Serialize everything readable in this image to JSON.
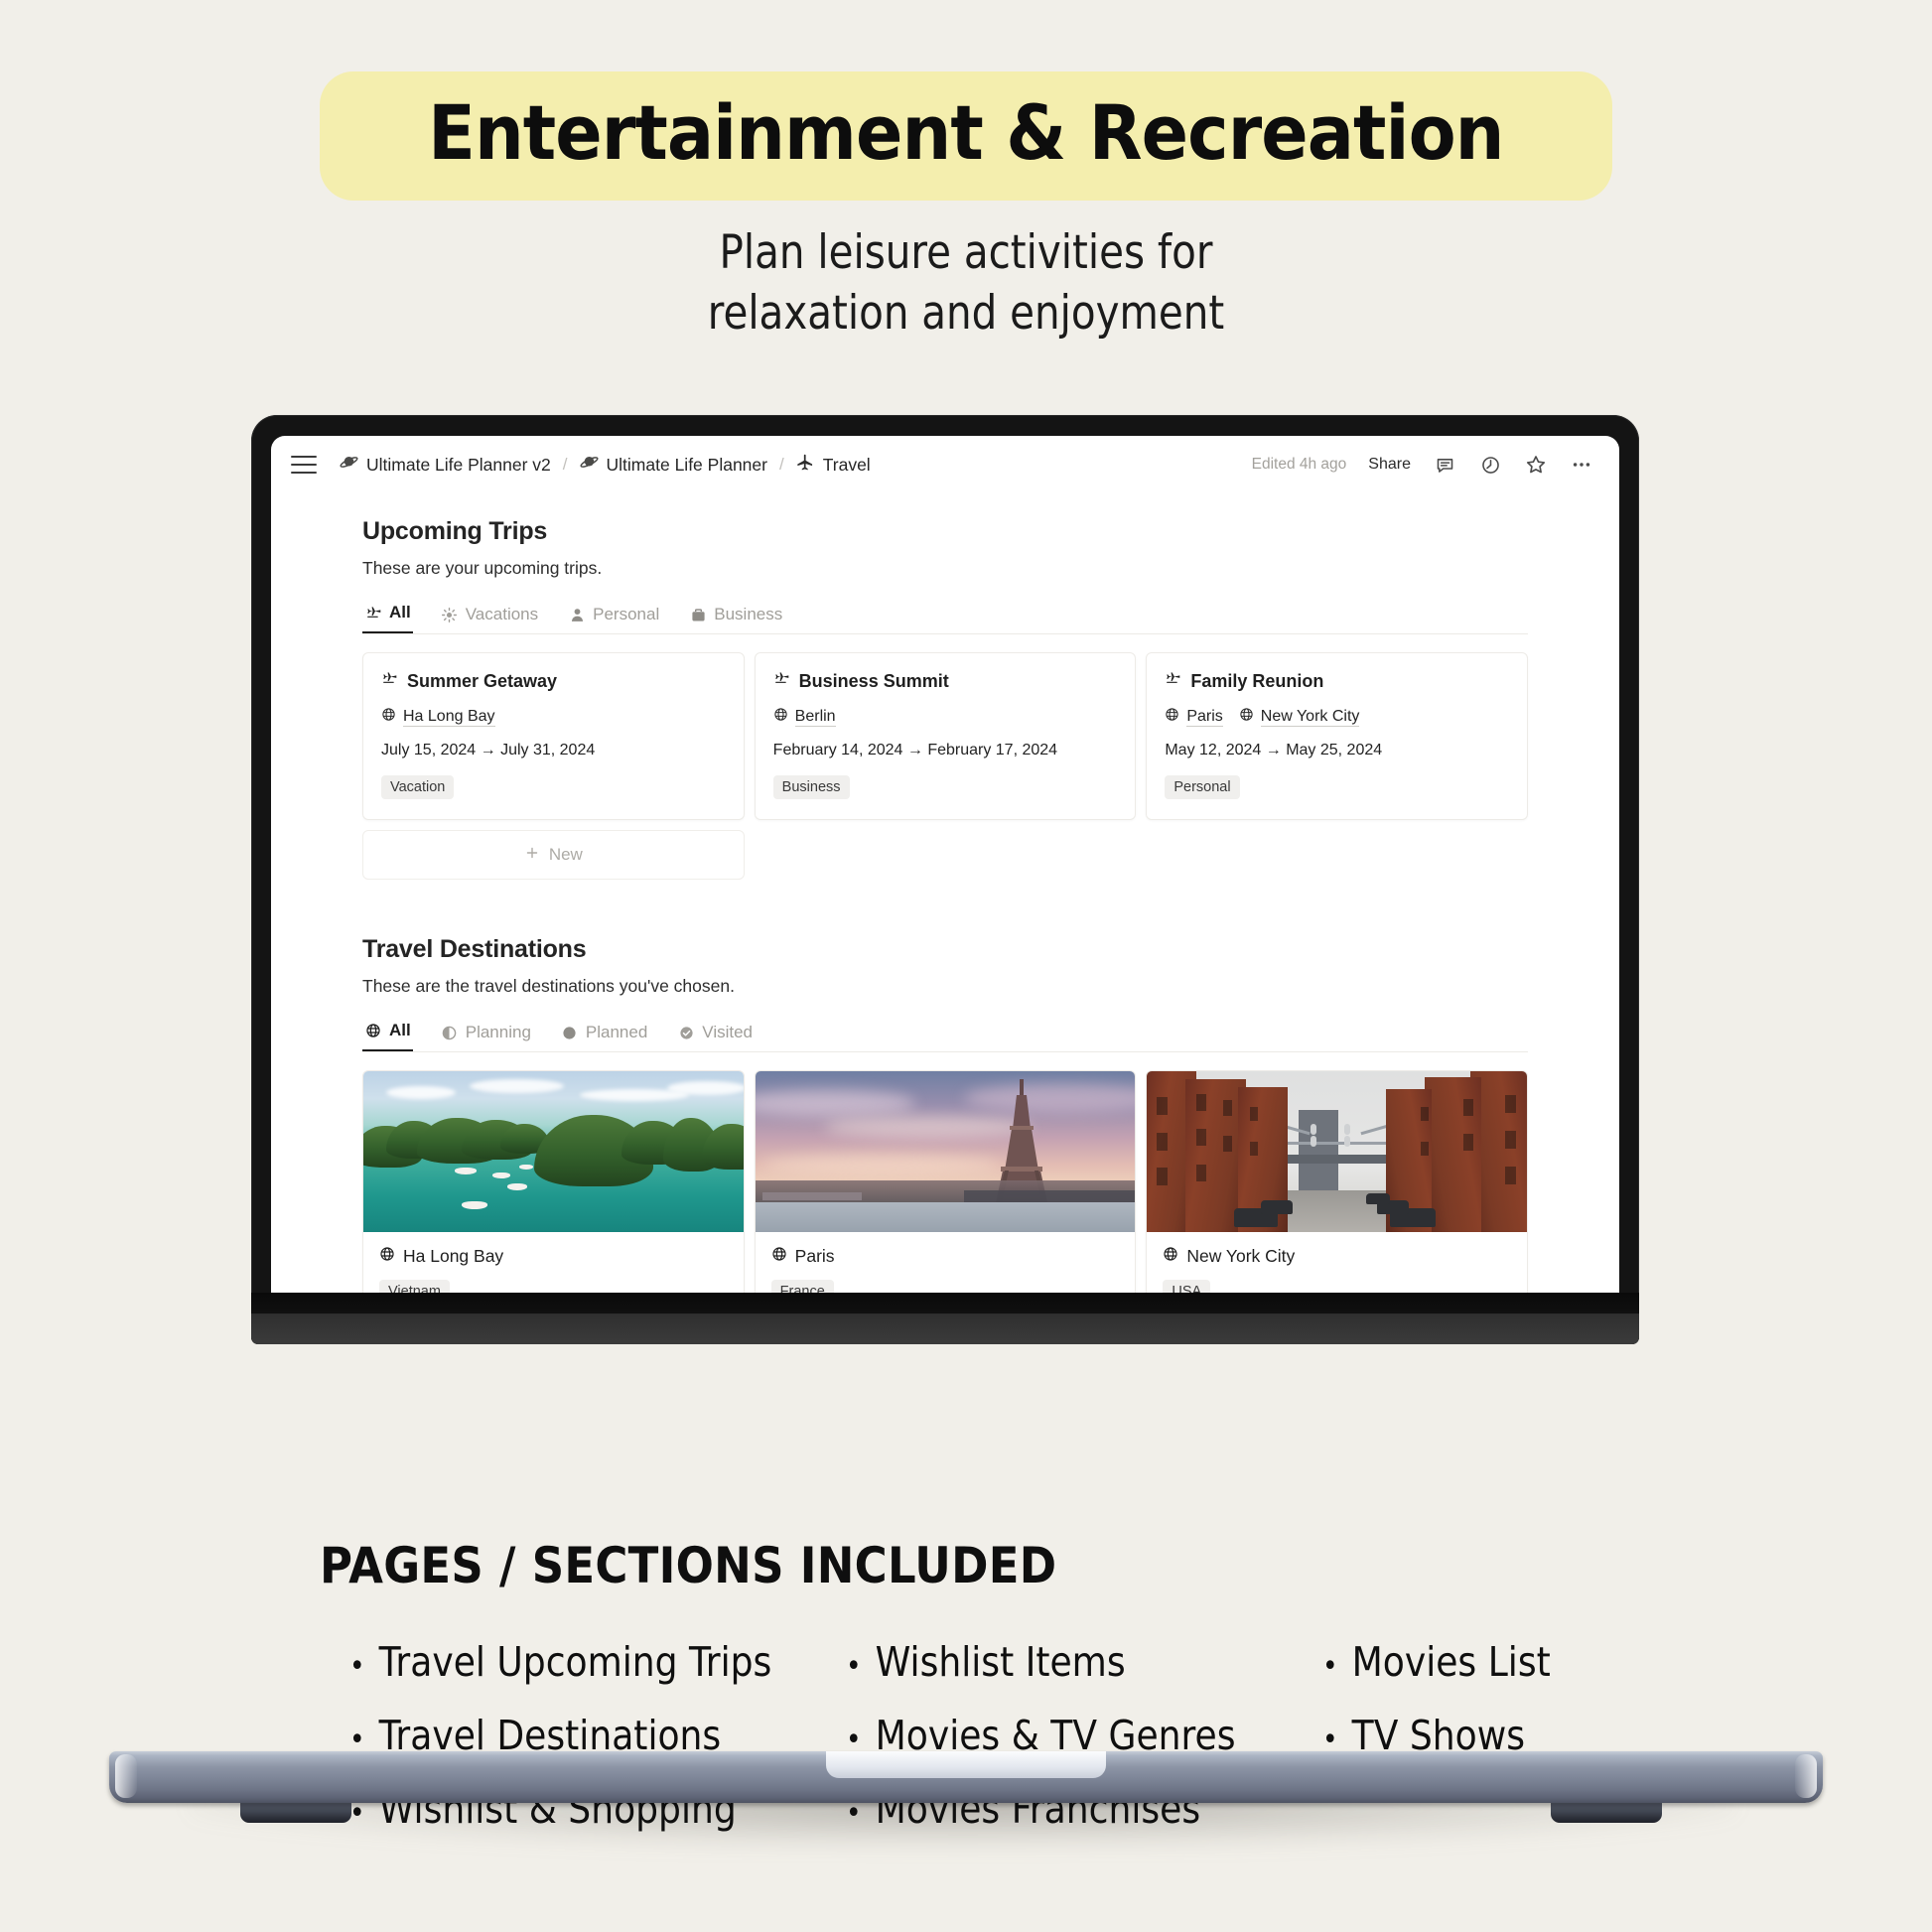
{
  "hero": {
    "title": "Entertainment & Recreation",
    "subtitle_line1": "Plan leisure activities for",
    "subtitle_line2": "relaxation and enjoyment",
    "pill_color": "#f4eeae",
    "background_color": "#f1efe9"
  },
  "app": {
    "topbar": {
      "menu_icon": "hamburger-menu-icon",
      "breadcrumbs": [
        {
          "icon": "saturn-planet-icon",
          "label": "Ultimate Life Planner v2"
        },
        {
          "icon": "saturn-planet-icon",
          "label": "Ultimate Life Planner"
        },
        {
          "icon": "airplane-icon",
          "label": "Travel"
        }
      ],
      "separator": "/",
      "edited": "Edited 4h ago",
      "share": "Share",
      "icons": [
        "comment-icon",
        "clock-history-icon",
        "star-favorite-icon",
        "more-options-icon"
      ]
    },
    "upcoming_trips": {
      "title": "Upcoming Trips",
      "description": "These are your upcoming trips.",
      "tabs": [
        {
          "icon": "airplane-icon",
          "label": "All",
          "active": true
        },
        {
          "icon": "sun-icon",
          "label": "Vacations",
          "active": false
        },
        {
          "icon": "person-icon",
          "label": "Personal",
          "active": false
        },
        {
          "icon": "briefcase-icon",
          "label": "Business",
          "active": false
        }
      ],
      "cards": [
        {
          "icon": "airplane-icon",
          "name": "Summer Getaway",
          "locations": [
            "Ha Long Bay"
          ],
          "dates": "July 15, 2024 → July 31, 2024",
          "tag": "Vacation"
        },
        {
          "icon": "airplane-icon",
          "name": "Business Summit",
          "locations": [
            "Berlin"
          ],
          "dates": "February 14, 2024 → February 17, 2024",
          "tag": "Business"
        },
        {
          "icon": "airplane-icon",
          "name": "Family Reunion",
          "locations": [
            "Paris",
            "New York City"
          ],
          "dates": "May 12, 2024 → May 25, 2024",
          "tag": "Personal"
        }
      ],
      "new_button": "New",
      "new_button_icon": "plus-icon"
    },
    "travel_destinations": {
      "title": "Travel Destinations",
      "description": "These are the travel destinations you've chosen.",
      "tabs": [
        {
          "icon": "globe-icon",
          "label": "All",
          "active": true
        },
        {
          "icon": "half-circle-icon",
          "label": "Planning",
          "active": false
        },
        {
          "icon": "filled-circle-icon",
          "label": "Planned",
          "active": false
        },
        {
          "icon": "check-circle-icon",
          "label": "Visited",
          "active": false
        }
      ],
      "cards": [
        {
          "image": "ha-long-bay-photo",
          "icon": "globe-icon",
          "name": "Ha Long Bay",
          "tag": "Vietnam"
        },
        {
          "image": "paris-eiffel-tower-photo",
          "icon": "globe-icon",
          "name": "Paris",
          "tag": "France"
        },
        {
          "image": "new-york-city-dumbo-photo",
          "icon": "globe-icon",
          "name": "New York City",
          "tag": "USA"
        }
      ]
    }
  },
  "footer": {
    "title": "PAGES / SECTIONS INCLUDED",
    "columns": [
      [
        "Travel Upcoming Trips",
        "Travel Destinations",
        "Wishlist & Shopping"
      ],
      [
        "Wishlist Items",
        "Movies & TV Genres",
        "Movies Franchises"
      ],
      [
        "Movies List",
        "TV Shows"
      ]
    ],
    "bullet": "•"
  }
}
